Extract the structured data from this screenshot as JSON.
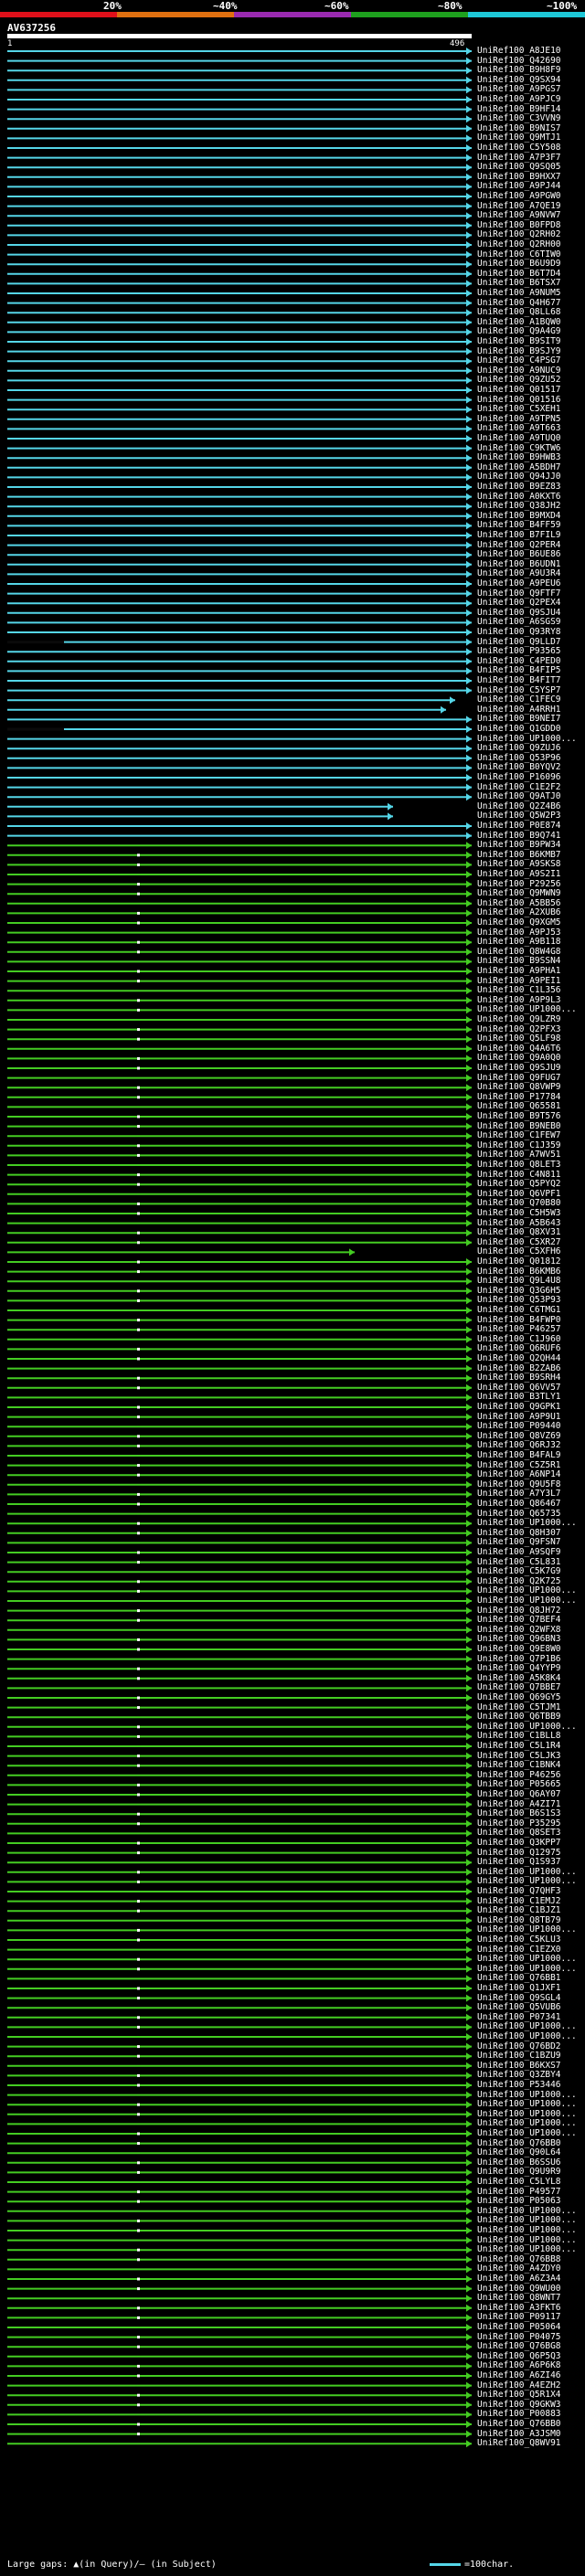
{
  "colors": {
    "scale": [
      "#e0101a",
      "#e07010",
      "#9a2ab0",
      "#1ea01e",
      "#1ec8d8"
    ],
    "hit_cyan": "#55d6e8",
    "hit_green": "#44cc22",
    "hit_dark": "#0a0a0a"
  },
  "scale_labels": [
    "20%",
    "~40%",
    "~60%",
    "~80%",
    "~100%"
  ],
  "query": {
    "id": "AV637256",
    "start": "1",
    "end": "496"
  },
  "legend": {
    "left": "Large gaps: ▲(in Query)/‒ (in Subject)",
    "right": "=100char."
  },
  "hits": [
    "UniRef100_A8JE10",
    "UniRef100_Q42690",
    "UniRef100_B9H8F9",
    "UniRef100_Q9SX94",
    "UniRef100_A9PGS7",
    "UniRef100_A9PJC9",
    "UniRef100_B9HF14",
    "UniRef100_C3VVN9",
    "UniRef100_B9NIS7",
    "UniRef100_Q9MTJ1",
    "UniRef100_C5Y508",
    "UniRef100_A7P3F7",
    "UniRef100_Q9SQ05",
    "UniRef100_B9HXX7",
    "UniRef100_A9PJ44",
    "UniRef100_A9PGW0",
    "UniRef100_A7QE19",
    "UniRef100_A9NVW7",
    "UniRef100_B0FPD8",
    "UniRef100_Q2RH02",
    "UniRef100_Q2RH00",
    "UniRef100_C6TIW0",
    "UniRef100_B6U9D9",
    "UniRef100_B6T7D4",
    "UniRef100_B6TSX7",
    "UniRef100_A9NUM5",
    "UniRef100_Q4H677",
    "UniRef100_Q8LL68",
    "UniRef100_A1BQW0",
    "UniRef100_Q9A4G9",
    "UniRef100_B9SIT9",
    "UniRef100_B9SJY9",
    "UniRef100_C4PSG7",
    "UniRef100_A9NUC9",
    "UniRef100_Q9ZU52",
    "UniRef100_Q01517",
    "UniRef100_Q01516",
    "UniRef100_C5XEH1",
    "UniRef100_A9TPN5",
    "UniRef100_A9T663",
    "UniRef100_A9TUQ0",
    "UniRef100_C9KTW6",
    "UniRef100_B9HWB3",
    "UniRef100_A5BDH7",
    "UniRef100_Q94JJ0",
    "UniRef100_B9EZ83",
    "UniRef100_A0KXT6",
    "UniRef100_Q38JH2",
    "UniRef100_B9MXD4",
    "UniRef100_B4FF59",
    "UniRef100_B7FIL9",
    "UniRef100_Q2PER4",
    "UniRef100_B6UE86",
    "UniRef100_B6UDN1",
    "UniRef100_A9U3R4",
    "UniRef100_A9PEU6",
    "UniRef100_Q9FTF7",
    "UniRef100_Q2PEX4",
    "UniRef100_Q9SJU4",
    "UniRef100_A6SGS9",
    "UniRef100_Q93RY8",
    "UniRef100_Q9LLD7",
    "UniRef100_P93565",
    "UniRef100_C4PED0",
    "UniRef100_B4FIP5",
    "UniRef100_B4FIT7",
    "UniRef100_C5YSP7",
    "UniRef100_C1FEC9",
    "UniRef100_A4RRH1",
    "UniRef100_B9NEI7",
    "UniRef100_Q1GDD0",
    "UniRef100_UP1000...",
    "UniRef100_Q9ZUJ6",
    "UniRef100_Q53P96",
    "UniRef100_B0YQV2",
    "UniRef100_P16096",
    "UniRef100_C1E2F2",
    "UniRef100_Q9ATJ0",
    "UniRef100_Q2Z4B6",
    "UniRef100_Q5W2P3",
    "UniRef100_P0E874",
    "UniRef100_B9Q741",
    "UniRef100_B9PW34",
    "UniRef100_B6KMB7",
    "UniRef100_A9SKS8",
    "UniRef100_A9S2I1",
    "UniRef100_P29256",
    "UniRef100_Q9MWN9",
    "UniRef100_A5BB56",
    "UniRef100_A2XUB6",
    "UniRef100_Q9XGM5",
    "UniRef100_A9PJ53",
    "UniRef100_A9B118",
    "UniRef100_Q8W4G8",
    "UniRef100_B9SSN4",
    "UniRef100_A9PHA1",
    "UniRef100_A9PEI1",
    "UniRef100_C1L356",
    "UniRef100_A9P9L3",
    "UniRef100_UP1000...",
    "UniRef100_Q9LZR9",
    "UniRef100_Q2PFX3",
    "UniRef100_Q5LF98",
    "UniRef100_Q4A6T6",
    "UniRef100_Q9A0Q0",
    "UniRef100_Q9SJU9",
    "UniRef100_Q9FUG7",
    "UniRef100_Q8VWP9",
    "UniRef100_P17784",
    "UniRef100_Q65581",
    "UniRef100_B9T576",
    "UniRef100_B9NEB0",
    "UniRef100_C1FEW7",
    "UniRef100_C1J359",
    "UniRef100_A7WV51",
    "UniRef100_Q8LET3",
    "UniRef100_C4N811",
    "UniRef100_Q5PYQ2",
    "UniRef100_Q6VPF1",
    "UniRef100_Q70B80",
    "UniRef100_C5H5W3",
    "UniRef100_A5B643",
    "UniRef100_Q8XV31",
    "UniRef100_C5XR27",
    "UniRef100_C5XFH6",
    "UniRef100_Q01812",
    "UniRef100_B6KMB6",
    "UniRef100_Q9L4U8",
    "UniRef100_Q3G6H5",
    "UniRef100_Q53P93",
    "UniRef100_C6TMG1",
    "UniRef100_B4FWP0",
    "UniRef100_P46257",
    "UniRef100_C1J960",
    "UniRef100_Q6RUF6",
    "UniRef100_Q2QH44",
    "UniRef100_B2ZAB6",
    "UniRef100_B9SRH4",
    "UniRef100_Q6VV57",
    "UniRef100_B3TLY1",
    "UniRef100_Q9GPK1",
    "UniRef100_A9P9U1",
    "UniRef100_P09440",
    "UniRef100_Q8VZ69",
    "UniRef100_Q6RJ32",
    "UniRef100_B4FAL9",
    "UniRef100_C5Z5R1",
    "UniRef100_A6NP14",
    "UniRef100_Q9U5F8",
    "UniRef100_A7Y3L7",
    "UniRef100_Q86467",
    "UniRef100_Q65735",
    "UniRef100_UP1000...",
    "UniRef100_Q8H307",
    "UniRef100_Q9FSN7",
    "UniRef100_A9SQF9",
    "UniRef100_C5L831",
    "UniRef100_C5K7G9",
    "UniRef100_Q2K725",
    "UniRef100_UP1000...",
    "UniRef100_UP1000...",
    "UniRef100_Q8JH72",
    "UniRef100_Q7BEF4",
    "UniRef100_Q2WFX8",
    "UniRef100_Q96BN3",
    "UniRef100_Q9E8W0",
    "UniRef100_Q7P1B6",
    "UniRef100_Q4YYP9",
    "UniRef100_A5K8K4",
    "UniRef100_Q7BBE7",
    "UniRef100_Q69GY5",
    "UniRef100_C5TJM1",
    "UniRef100_Q6TBB9",
    "UniRef100_UP1000...",
    "UniRef100_C1BLL8",
    "UniRef100_C5L1R4",
    "UniRef100_C5LJK3",
    "UniRef100_C1BNK4",
    "UniRef100_P46256",
    "UniRef100_P05665",
    "UniRef100_Q6AY07",
    "UniRef100_A4ZI71",
    "UniRef100_B6S1S3",
    "UniRef100_P35295",
    "UniRef100_Q8SET3",
    "UniRef100_Q3KPP7",
    "UniRef100_Q12975",
    "UniRef100_Q1S937",
    "UniRef100_UP1000...",
    "UniRef100_UP1000...",
    "UniRef100_Q7QHF3",
    "UniRef100_C1EMJ2",
    "UniRef100_C1BJZ1",
    "UniRef100_Q8TB79",
    "UniRef100_UP1000...",
    "UniRef100_C5KLU3",
    "UniRef100_C1EZX0",
    "UniRef100_UP1000...",
    "UniRef100_UP1000...",
    "UniRef100_Q76BB1",
    "UniRef100_Q1JXF1",
    "UniRef100_Q9SGL4",
    "UniRef100_Q5VUB6",
    "UniRef100_P07341",
    "UniRef100_UP1000...",
    "UniRef100_UP1000...",
    "UniRef100_Q76BD2",
    "UniRef100_C1BZU9",
    "UniRef100_B6KXS7",
    "UniRef100_Q3ZBY4",
    "UniRef100_P53446",
    "UniRef100_UP1000...",
    "UniRef100_UP1000...",
    "UniRef100_UP1000...",
    "UniRef100_UP1000...",
    "UniRef100_UP1000...",
    "UniRef100_Q76BB0",
    "UniRef100_Q90L64",
    "UniRef100_B6SSU6",
    "UniRef100_Q9U9R9",
    "UniRef100_C5LYL8",
    "UniRef100_P49577",
    "UniRef100_P05063",
    "UniRef100_UP1000...",
    "UniRef100_UP1000...",
    "UniRef100_UP1000...",
    "UniRef100_UP1000...",
    "UniRef100_UP1000...",
    "UniRef100_Q76BB8",
    "UniRef100_A4ZDY0",
    "UniRef100_A6Z3A4",
    "UniRef100_Q9WU00",
    "UniRef100_Q8WNT7",
    "UniRef100_A3FKT6",
    "UniRef100_P09117",
    "UniRef100_P05064",
    "UniRef100_P04075",
    "UniRef100_Q76BG8",
    "UniRef100_Q6P5Q3",
    "UniRef100_A6P6K8",
    "UniRef100_A6ZI46",
    "UniRef100_A4EZH2",
    "UniRef100_Q5R1X4",
    "UniRef100_Q9GKW3",
    "UniRef100_P00883",
    "UniRef100_Q76BB0",
    "UniRef100_A3JSM0",
    "UniRef100_Q8WV91"
  ]
}
